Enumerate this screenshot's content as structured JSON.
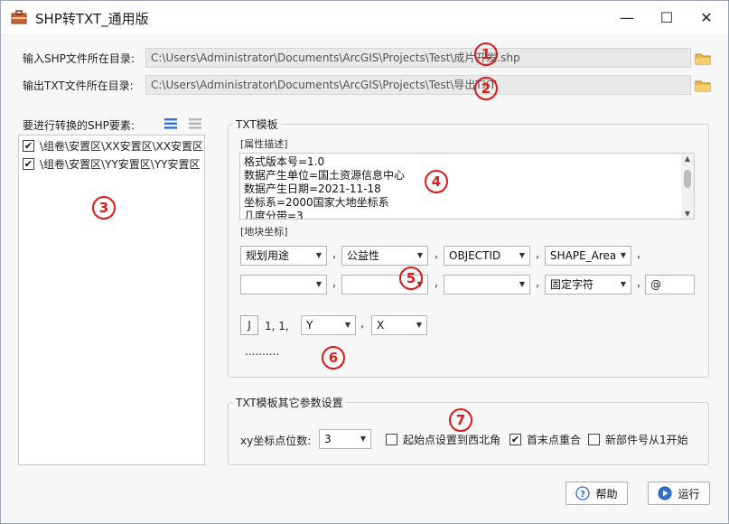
{
  "window": {
    "title": "SHP转TXT_通用版",
    "minimize": "—",
    "maximize": "☐",
    "close": "✕"
  },
  "input_dir": {
    "label": "输入SHP文件所在目录:",
    "value": "C:\\Users\\Administrator\\Documents\\ArcGIS\\Projects\\Test\\成片开发.shp"
  },
  "output_dir": {
    "label": "输出TXT文件所在目录:",
    "value": "C:\\Users\\Administrator\\Documents\\ArcGIS\\Projects\\Test\\导出TXT"
  },
  "shp_list": {
    "label": "要进行转换的SHP要素:",
    "items": [
      {
        "text": "\\组卷\\安置区\\XX安置区\\XX安置区",
        "checked": true
      },
      {
        "text": "\\组卷\\安置区\\YY安置区\\YY安置区",
        "checked": true
      }
    ]
  },
  "txt_template": {
    "title": "TXT模板",
    "attr_label": "[属性描述]",
    "attr_lines": [
      "格式版本号=1.0",
      "数据产生单位=国土资源信息中心",
      "数据产生日期=2021-11-18",
      "坐标系=2000国家大地坐标系",
      "几度分带=3"
    ],
    "coord_label": "[地块坐标]",
    "row1": [
      "规划用途",
      "公益性",
      "OBJECTID",
      "SHAPE_Area"
    ],
    "row2": [
      "",
      "",
      "",
      "固定字符"
    ],
    "row2_input": "@",
    "sep": ",",
    "point_btn": "J",
    "point_text": "1,  1,",
    "y_combo": "Y",
    "x_combo": "X",
    "ellipsis": ".........."
  },
  "other_params": {
    "title": "TXT模板其它参数设置",
    "xy_digits_label": "xy坐标点位数:",
    "xy_digits_value": "3",
    "start_nw": {
      "label": "起始点设置到西北角",
      "checked": false
    },
    "first_last": {
      "label": "首末点重合",
      "checked": true
    },
    "new_part": {
      "label": "新部件号从1开始",
      "checked": false
    }
  },
  "buttons": {
    "help": "帮助",
    "run": "运行"
  },
  "markers": [
    "1",
    "2",
    "3",
    "4",
    "5",
    "6",
    "7"
  ],
  "colors": {
    "marker": "#e01818",
    "accent": "#2f6fd6"
  }
}
